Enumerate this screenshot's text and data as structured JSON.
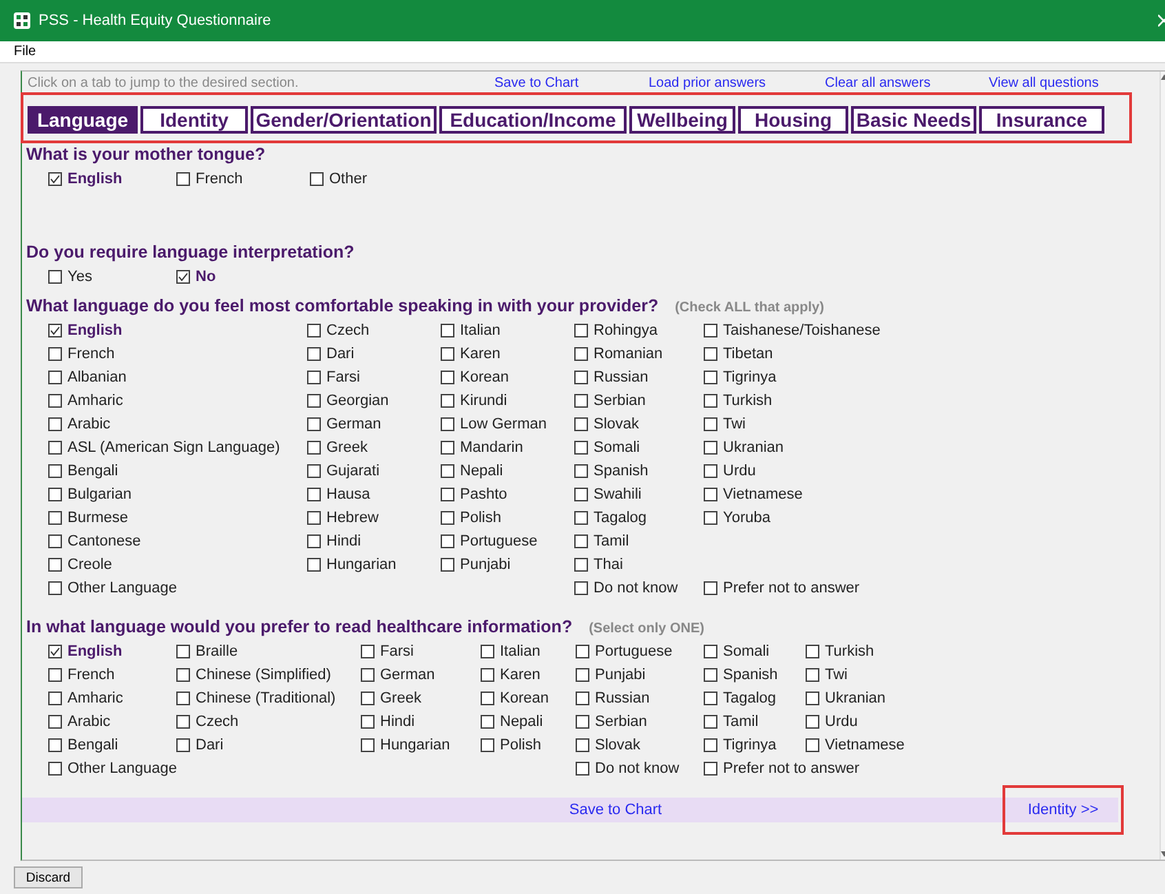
{
  "window": {
    "title": "PSS - Health Equity Questionnaire",
    "menu": [
      "File"
    ]
  },
  "instructions": "Click on a tab to jump to the desired section.",
  "top_links": [
    "Save to Chart",
    "Load prior answers",
    "Clear all answers",
    "View all questions"
  ],
  "tabs_highlighted": true,
  "tabs": [
    {
      "label": "Language",
      "selected": true
    },
    {
      "label": "Identity",
      "selected": false
    },
    {
      "label": "Gender/Orientation",
      "selected": false
    },
    {
      "label": "Education/Income",
      "selected": false
    },
    {
      "label": "Wellbeing",
      "selected": false
    },
    {
      "label": "Housing",
      "selected": false
    },
    {
      "label": "Basic Needs",
      "selected": false
    },
    {
      "label": "Insurance",
      "selected": false
    }
  ],
  "questions": [
    {
      "text": "What is your mother tongue?",
      "columns": [
        [
          {
            "label": "English",
            "checked": true,
            "kind": "option"
          }
        ],
        [
          {
            "label": "French",
            "checked": false,
            "kind": "option"
          }
        ],
        [
          {
            "label": "Other",
            "checked": false,
            "kind": "option"
          }
        ]
      ]
    },
    {
      "text": "Do you require language interpretation?",
      "columns": [
        [
          {
            "label": "Yes",
            "checked": false,
            "kind": "option"
          }
        ],
        [
          {
            "label": "No",
            "checked": true,
            "kind": "option"
          }
        ]
      ]
    },
    {
      "text": "What language do you feel most comfortable speaking in with your provider?",
      "hint": "(Check ALL that apply)",
      "columns": [
        [
          {
            "label": "English",
            "checked": true,
            "kind": "option"
          },
          {
            "label": "French",
            "checked": false,
            "kind": "option"
          },
          {
            "label": "Albanian",
            "checked": false,
            "kind": "option"
          },
          {
            "label": "Amharic",
            "checked": false,
            "kind": "option"
          },
          {
            "label": "Arabic",
            "checked": false,
            "kind": "option"
          },
          {
            "label": "ASL (American Sign Language)",
            "checked": false,
            "kind": "option"
          },
          {
            "label": "Bengali",
            "checked": false,
            "kind": "option"
          },
          {
            "label": "Bulgarian",
            "checked": false,
            "kind": "option"
          },
          {
            "label": "Burmese",
            "checked": false,
            "kind": "option"
          },
          {
            "label": "Cantonese",
            "checked": false,
            "kind": "option"
          },
          {
            "label": "Creole",
            "checked": false,
            "kind": "option"
          },
          {
            "label": "Other Language",
            "checked": false,
            "kind": "opt_out"
          }
        ],
        [
          {
            "label": "Czech",
            "checked": false,
            "kind": "option"
          },
          {
            "label": "Dari",
            "checked": false,
            "kind": "option"
          },
          {
            "label": "Farsi",
            "checked": false,
            "kind": "option"
          },
          {
            "label": "Georgian",
            "checked": false,
            "kind": "option"
          },
          {
            "label": "German",
            "checked": false,
            "kind": "option"
          },
          {
            "label": "Greek",
            "checked": false,
            "kind": "option"
          },
          {
            "label": "Gujarati",
            "checked": false,
            "kind": "option"
          },
          {
            "label": "Hausa",
            "checked": false,
            "kind": "option"
          },
          {
            "label": "Hebrew",
            "checked": false,
            "kind": "option"
          },
          {
            "label": "Hindi",
            "checked": false,
            "kind": "option"
          },
          {
            "label": "Hungarian",
            "checked": false,
            "kind": "option"
          }
        ],
        [
          {
            "label": "Italian",
            "checked": false,
            "kind": "option"
          },
          {
            "label": "Karen",
            "checked": false,
            "kind": "option"
          },
          {
            "label": "Korean",
            "checked": false,
            "kind": "option"
          },
          {
            "label": "Kirundi",
            "checked": false,
            "kind": "option"
          },
          {
            "label": "Low German",
            "checked": false,
            "kind": "option"
          },
          {
            "label": "Mandarin",
            "checked": false,
            "kind": "option"
          },
          {
            "label": "Nepali",
            "checked": false,
            "kind": "option"
          },
          {
            "label": "Pashto",
            "checked": false,
            "kind": "option"
          },
          {
            "label": "Polish",
            "checked": false,
            "kind": "option"
          },
          {
            "label": "Portuguese",
            "checked": false,
            "kind": "option"
          },
          {
            "label": "Punjabi",
            "checked": false,
            "kind": "option"
          }
        ],
        [
          {
            "label": "Rohingya",
            "checked": false,
            "kind": "option"
          },
          {
            "label": "Romanian",
            "checked": false,
            "kind": "option"
          },
          {
            "label": "Russian",
            "checked": false,
            "kind": "option"
          },
          {
            "label": "Serbian",
            "checked": false,
            "kind": "option"
          },
          {
            "label": "Slovak",
            "checked": false,
            "kind": "option"
          },
          {
            "label": "Somali",
            "checked": false,
            "kind": "option"
          },
          {
            "label": "Spanish",
            "checked": false,
            "kind": "option"
          },
          {
            "label": "Swahili",
            "checked": false,
            "kind": "option"
          },
          {
            "label": "Tagalog",
            "checked": false,
            "kind": "option"
          },
          {
            "label": "Tamil",
            "checked": false,
            "kind": "option"
          },
          {
            "label": "Thai",
            "checked": false,
            "kind": "option"
          },
          {
            "label": "Do not know",
            "checked": false,
            "kind": "opt_out"
          }
        ],
        [
          {
            "label": "Taishanese/Toishanese",
            "checked": false,
            "kind": "option"
          },
          {
            "label": "Tibetan",
            "checked": false,
            "kind": "option"
          },
          {
            "label": "Tigrinya",
            "checked": false,
            "kind": "option"
          },
          {
            "label": "Turkish",
            "checked": false,
            "kind": "option"
          },
          {
            "label": "Twi",
            "checked": false,
            "kind": "option"
          },
          {
            "label": "Ukranian",
            "checked": false,
            "kind": "option"
          },
          {
            "label": "Urdu",
            "checked": false,
            "kind": "option"
          },
          {
            "label": "Vietnamese",
            "checked": false,
            "kind": "option"
          },
          {
            "label": "Yoruba",
            "checked": false,
            "kind": "option"
          },
          {
            "label": "Prefer not to answer",
            "checked": false,
            "kind": "opt_out"
          }
        ]
      ]
    },
    {
      "text": "In what language would you prefer to read healthcare information?",
      "hint": "(Select only ONE)",
      "columns": [
        [
          {
            "label": "English",
            "checked": true,
            "kind": "option"
          },
          {
            "label": "French",
            "checked": false,
            "kind": "option"
          },
          {
            "label": "Amharic",
            "checked": false,
            "kind": "option"
          },
          {
            "label": "Arabic",
            "checked": false,
            "kind": "option"
          },
          {
            "label": "Bengali",
            "checked": false,
            "kind": "option"
          },
          {
            "label": "Other Language",
            "checked": false,
            "kind": "opt_out"
          }
        ],
        [
          {
            "label": "Braille",
            "checked": false,
            "kind": "option"
          },
          {
            "label": "Chinese (Simplified)",
            "checked": false,
            "kind": "option"
          },
          {
            "label": "Chinese (Traditional)",
            "checked": false,
            "kind": "option"
          },
          {
            "label": "Czech",
            "checked": false,
            "kind": "option"
          },
          {
            "label": "Dari",
            "checked": false,
            "kind": "option"
          }
        ],
        [
          {
            "label": "Farsi",
            "checked": false,
            "kind": "option"
          },
          {
            "label": "German",
            "checked": false,
            "kind": "option"
          },
          {
            "label": "Greek",
            "checked": false,
            "kind": "option"
          },
          {
            "label": "Hindi",
            "checked": false,
            "kind": "option"
          },
          {
            "label": "Hungarian",
            "checked": false,
            "kind": "option"
          }
        ],
        [
          {
            "label": "Italian",
            "checked": false,
            "kind": "option"
          },
          {
            "label": "Karen",
            "checked": false,
            "kind": "option"
          },
          {
            "label": "Korean",
            "checked": false,
            "kind": "option"
          },
          {
            "label": "Nepali",
            "checked": false,
            "kind": "option"
          },
          {
            "label": "Polish",
            "checked": false,
            "kind": "option"
          }
        ],
        [
          {
            "label": "Portuguese",
            "checked": false,
            "kind": "option"
          },
          {
            "label": "Punjabi",
            "checked": false,
            "kind": "option"
          },
          {
            "label": "Russian",
            "checked": false,
            "kind": "option"
          },
          {
            "label": "Serbian",
            "checked": false,
            "kind": "option"
          },
          {
            "label": "Slovak",
            "checked": false,
            "kind": "option"
          },
          {
            "label": "Do not know",
            "checked": false,
            "kind": "opt_out"
          }
        ],
        [
          {
            "label": "Somali",
            "checked": false,
            "kind": "option"
          },
          {
            "label": "Spanish",
            "checked": false,
            "kind": "option"
          },
          {
            "label": "Tagalog",
            "checked": false,
            "kind": "option"
          },
          {
            "label": "Tamil",
            "checked": false,
            "kind": "option"
          },
          {
            "label": "Tigrinya",
            "checked": false,
            "kind": "option"
          },
          {
            "label": "Prefer not to answer",
            "checked": false,
            "kind": "opt_out"
          }
        ],
        [
          {
            "label": "Turkish",
            "checked": false,
            "kind": "option"
          },
          {
            "label": "Twi",
            "checked": false,
            "kind": "option"
          },
          {
            "label": "Ukranian",
            "checked": false,
            "kind": "option"
          },
          {
            "label": "Urdu",
            "checked": false,
            "kind": "option"
          },
          {
            "label": "Vietnamese",
            "checked": false,
            "kind": "option"
          }
        ]
      ]
    }
  ],
  "save_bar": {
    "save": "Save to Chart",
    "next": "Identity >>",
    "next_highlighted": true
  },
  "footer": {
    "discard": "Discard"
  }
}
